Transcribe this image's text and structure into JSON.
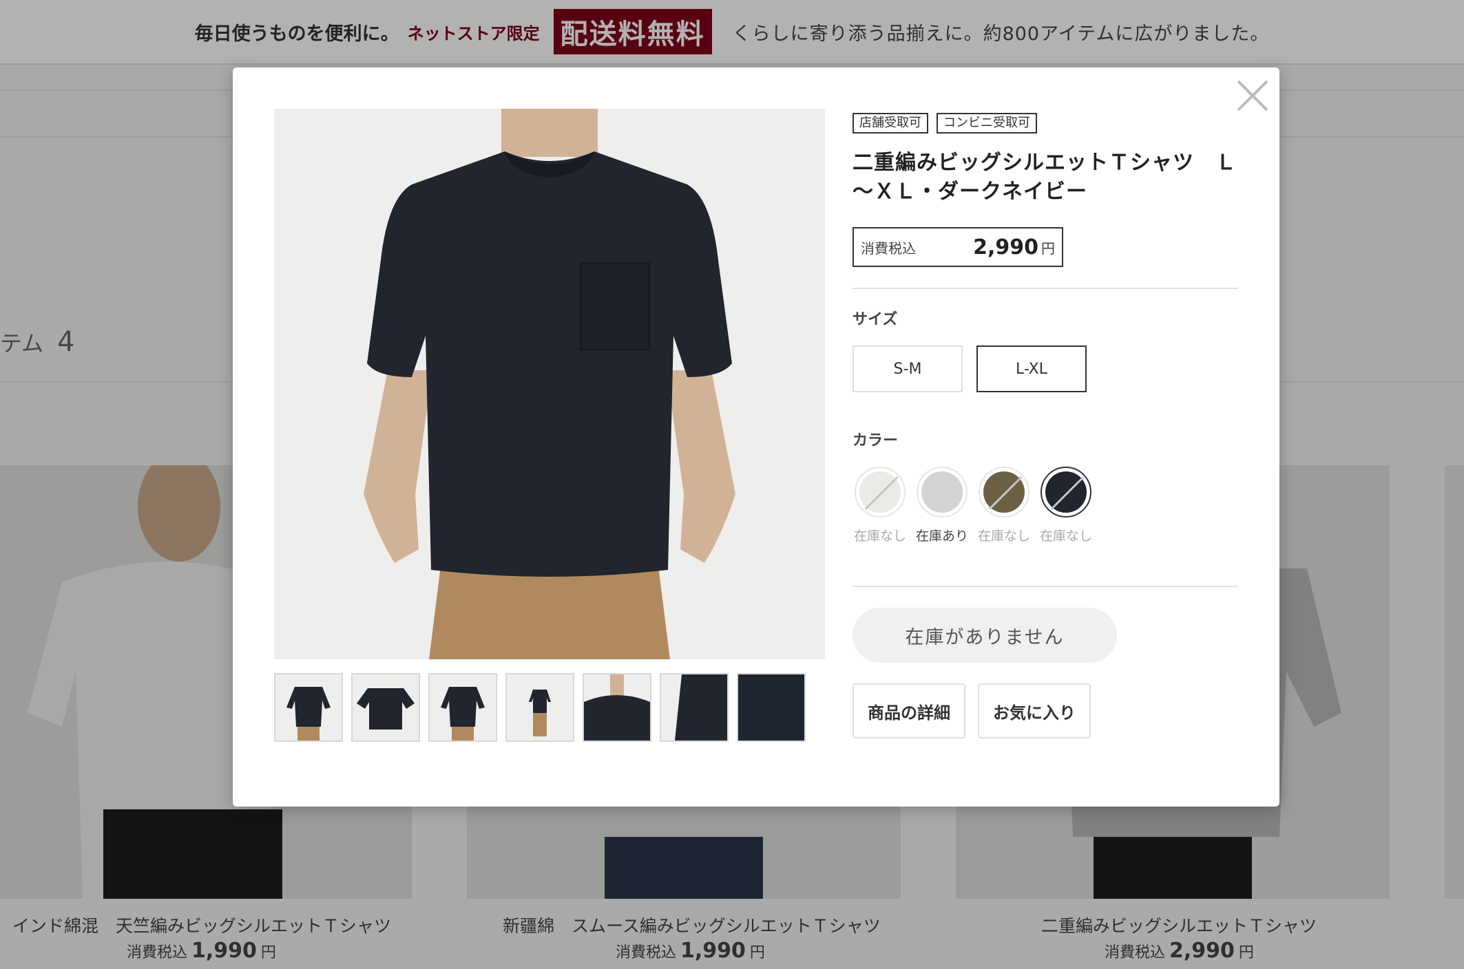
{
  "banner": {
    "lead": "毎日使うものを便利に。",
    "store_limited": "ネットストア限定",
    "free_shipping": "配送料無料",
    "tail": "くらしに寄り添う品揃えに。約800アイテムに広がりました。"
  },
  "background": {
    "item_count_label": "テム",
    "item_count": "4",
    "cards": [
      {
        "name": "インド綿混　天竺編みビッグシルエットＴシャツ",
        "tax_label": "消費税込",
        "price": "1,990",
        "yen": "円"
      },
      {
        "name": "新疆綿　スムース編みビッグシルエットＴシャツ",
        "tax_label": "消費税込",
        "price": "1,990",
        "yen": "円"
      },
      {
        "name": "二重編みビッグシルエットＴシャツ",
        "tax_label": "消費税込",
        "price": "2,990",
        "yen": "円"
      }
    ]
  },
  "modal": {
    "tags": [
      "店舗受取可",
      "コンビニ受取可"
    ],
    "title": "二重編みビッグシルエットＴシャツ　Ｌ～ＸＬ・ダークネイビー",
    "price_label": "消費税込",
    "price": "2,990",
    "yen": "円",
    "size_label": "サイズ",
    "sizes": [
      {
        "label": "S-M",
        "selected": false
      },
      {
        "label": "L-XL",
        "selected": true
      }
    ],
    "color_label": "カラー",
    "colors": [
      {
        "name": "off-white",
        "hex": "#eaeae6",
        "stock": "在庫なし",
        "in_stock": false,
        "selected": false
      },
      {
        "name": "light-gray",
        "hex": "#d3d3d1",
        "stock": "在庫あり",
        "in_stock": true,
        "selected": false
      },
      {
        "name": "khaki-green",
        "hex": "#6b6142",
        "stock": "在庫なし",
        "in_stock": false,
        "selected": false
      },
      {
        "name": "dark-navy",
        "hex": "#20252e",
        "stock": "在庫なし",
        "in_stock": false,
        "selected": true
      }
    ],
    "out_of_stock_button": "在庫がありません",
    "details_button": "商品の詳細",
    "favorite_button": "お気に入り",
    "thumbnail_count": 7
  },
  "colors": {
    "brand_red": "#7f0019",
    "navy": "#20252e",
    "khaki": "#b08a5e"
  }
}
